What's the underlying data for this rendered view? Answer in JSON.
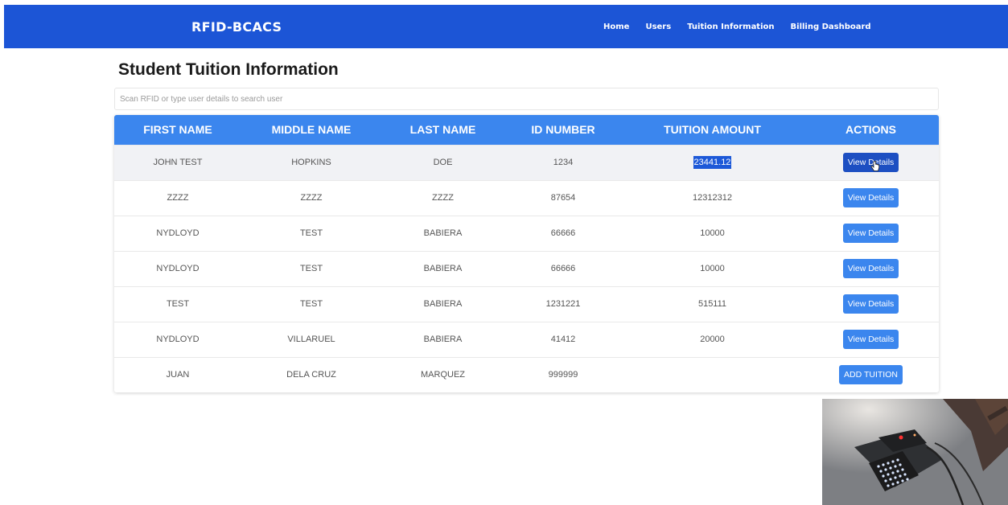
{
  "nav": {
    "brand": "RFID-BCACS",
    "links": [
      "Home",
      "Users",
      "Tuition Information",
      "Billing Dashboard"
    ]
  },
  "page": {
    "title": "Student Tuition Information"
  },
  "search": {
    "placeholder": "Scan RFID or type user details to search user",
    "value": ""
  },
  "table": {
    "headers": [
      "FIRST NAME",
      "MIDDLE NAME",
      "LAST NAME",
      "ID NUMBER",
      "TUITION AMOUNT",
      "ACTIONS"
    ],
    "rows": [
      {
        "first": "JOHN TEST",
        "middle": "HOPKINS",
        "last": "DOE",
        "id": "1234",
        "tuition": "23441.12",
        "action": "View Details"
      },
      {
        "first": "ZZZZ",
        "middle": "ZZZZ",
        "last": "ZZZZ",
        "id": "87654",
        "tuition": "12312312",
        "action": "View Details"
      },
      {
        "first": "NYDLOYD",
        "middle": "TEST",
        "last": "BABIERA",
        "id": "66666",
        "tuition": "10000",
        "action": "View Details"
      },
      {
        "first": "NYDLOYD",
        "middle": "TEST",
        "last": "BABIERA",
        "id": "66666",
        "tuition": "10000",
        "action": "View Details"
      },
      {
        "first": "TEST",
        "middle": "TEST",
        "last": "BABIERA",
        "id": "1231221",
        "tuition": "515111",
        "action": "View Details"
      },
      {
        "first": "NYDLOYD",
        "middle": "VILLARUEL",
        "last": "BABIERA",
        "id": "41412",
        "tuition": "20000",
        "action": "View Details"
      },
      {
        "first": "JUAN",
        "middle": "DELA CRUZ",
        "last": "MARQUEZ",
        "id": "999999",
        "tuition": "",
        "action": "ADD TUITION"
      }
    ]
  },
  "colors": {
    "navbar": "#1c55d6",
    "header": "#3b86ee",
    "button": "#3b86ee",
    "selection": "#1d59d8"
  }
}
